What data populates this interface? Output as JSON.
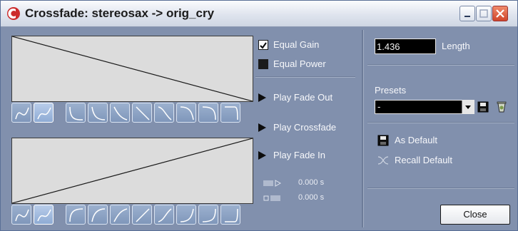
{
  "window": {
    "title": "Crossfade: stereosax -> orig_cry",
    "controls": [
      "minimize",
      "maximize",
      "close"
    ]
  },
  "options": {
    "equal_gain": {
      "label": "Equal Gain",
      "checked": true
    },
    "equal_power": {
      "label": "Equal Power",
      "checked": false
    }
  },
  "playback": {
    "play_fade_out": "Play Fade Out",
    "play_crossfade": "Play Crossfade",
    "play_fade_in": "Play Fade In",
    "pre_roll_time": "0.000 s",
    "post_roll_time": "0.000 s"
  },
  "length": {
    "value": "1.436",
    "label": "Length"
  },
  "presets": {
    "label": "Presets",
    "selected": "-",
    "as_default": "As Default",
    "recall_default": "Recall Default"
  },
  "footer": {
    "close_label": "Close"
  },
  "curves": {
    "fade_out_buttons": [
      "spline",
      "damped-spline",
      "curve1",
      "curve2",
      "curve3",
      "linear",
      "curve4",
      "curve5",
      "curve6",
      "curve7"
    ],
    "fade_in_buttons": [
      "spline",
      "damped-spline",
      "curve1",
      "curve2",
      "curve3",
      "linear",
      "curve4",
      "curve5",
      "curve6",
      "curve7"
    ],
    "active_index": 1
  },
  "colors": {
    "background": "#8190ad",
    "curve_display": "#dcdcdc",
    "button_active": "#b9cdea",
    "button_normal": "#8fa6c8"
  }
}
